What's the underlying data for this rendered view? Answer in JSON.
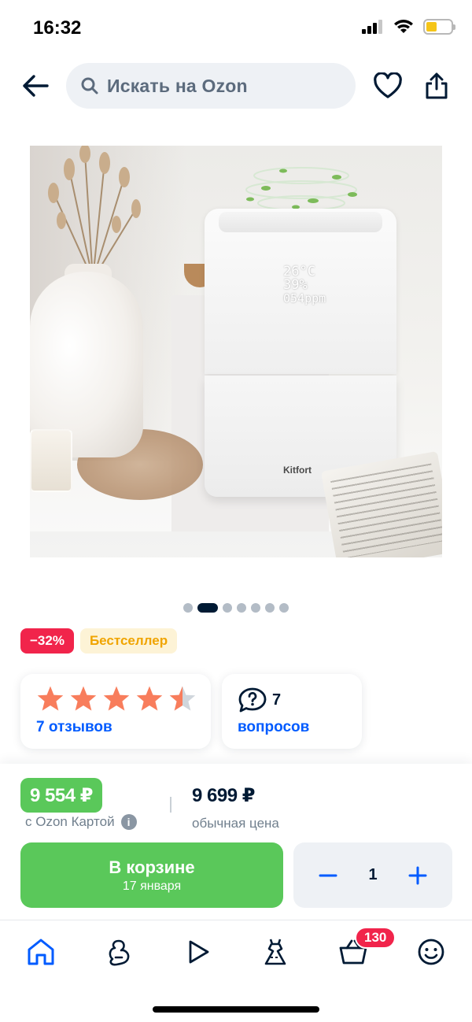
{
  "status_bar": {
    "time": "16:32",
    "battery_color": "#f5c518"
  },
  "header": {
    "search_placeholder": "Искать на Ozon",
    "icons": [
      "arrow-left-icon",
      "search-icon",
      "heart-icon",
      "share-icon"
    ]
  },
  "product": {
    "image_alt": "Kitfort air purifier",
    "display_lines": [
      "26°C",
      "39%",
      "054ppm"
    ],
    "brand_on_device": "Kitfort",
    "gallery": {
      "total": 7,
      "active": 2
    }
  },
  "badges": {
    "discount": "−32%",
    "bestseller": "Бестселлер"
  },
  "rating": {
    "stars": 4.5,
    "reviews_label": "7 отзывов"
  },
  "questions": {
    "count": "7",
    "label": "вопросов"
  },
  "pricing": {
    "card_price": "9 554 ₽",
    "card_price_label": "с Ozon Картой",
    "regular_price": "9 699 ₽",
    "regular_price_label": "обычная цена",
    "accent_color": "#5ac85a"
  },
  "cart": {
    "button_title": "В корзине",
    "button_subtitle": "17 января",
    "quantity": "1"
  },
  "tabbar": {
    "items": [
      "home-icon",
      "promo-icon",
      "video-icon",
      "fashion-icon",
      "cart-icon",
      "profile-icon"
    ],
    "cart_badge": "130",
    "active_color": "#005bff",
    "badge_color": "#f1244b"
  }
}
